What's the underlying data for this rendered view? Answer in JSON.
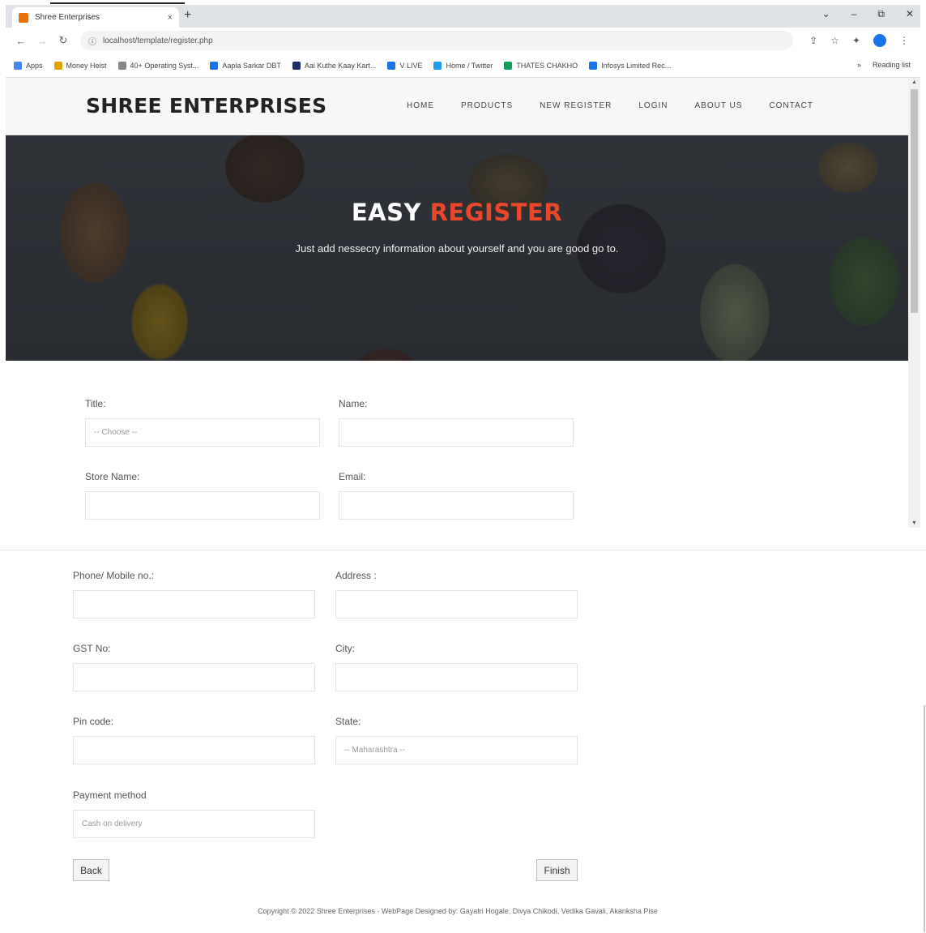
{
  "browser": {
    "tab_title": "Shree Enterprises",
    "tab_close": "×",
    "new_tab": "+",
    "url": "localhost/template/register.php",
    "window_controls": [
      "⌄",
      "–",
      "⧉",
      "✕"
    ],
    "bookmarks": [
      {
        "label": "Apps",
        "color": "#4285f4"
      },
      {
        "label": "Money Heist",
        "color": "#e0a200"
      },
      {
        "label": "40+ Operating Syst...",
        "color": "#888888"
      },
      {
        "label": "Aapla Sarkar DBT",
        "color": "#1a73e8"
      },
      {
        "label": "Aai Kuthe Kaay Kart...",
        "color": "#1f2d6b"
      },
      {
        "label": "V LIVE",
        "color": "#1a73e8"
      },
      {
        "label": "Home / Twitter",
        "color": "#1d9bf0"
      },
      {
        "label": "THATES CHAKHO",
        "color": "#0f9d58"
      },
      {
        "label": "Infosys Limited Rec...",
        "color": "#1a73e8"
      }
    ],
    "reading_list": "Reading list"
  },
  "site": {
    "logo": "SHREE ENTERPRISES",
    "menu": [
      "HOME",
      "PRODUCTS",
      "NEW REGISTER",
      "LOGIN",
      "ABOUT US",
      "CONTACT"
    ],
    "accent_color": "#e8472b"
  },
  "hero": {
    "title_part1": "EASY",
    "title_part2": "REGISTER",
    "subtitle": "Just add nessecry information about yourself and you are good go to."
  },
  "form_top": {
    "title_label": "Title:",
    "title_value": "-- Choose --",
    "name_label": "Name:",
    "name_value": "",
    "store_label": "Store Name:",
    "store_value": "",
    "email_label": "Email:",
    "email_value": ""
  },
  "form_bottom": {
    "phone_label": "Phone/ Mobile no.:",
    "address_label": "Address :",
    "gst_label": "GST No:",
    "city_label": "City:",
    "pin_label": "Pin code:",
    "state_label": "State:",
    "state_value": "-- Maharashtra --",
    "payment_label": "Payment method",
    "payment_value": "Cash on delivery"
  },
  "buttons": {
    "back": "Back",
    "finish": "Finish"
  },
  "footer": "Copyright © 2022 Shree Enterprises - WebPage Designed by: Gayatri Hogale, Divya Chikodi, Vedika Gavali, Akanksha Pise"
}
